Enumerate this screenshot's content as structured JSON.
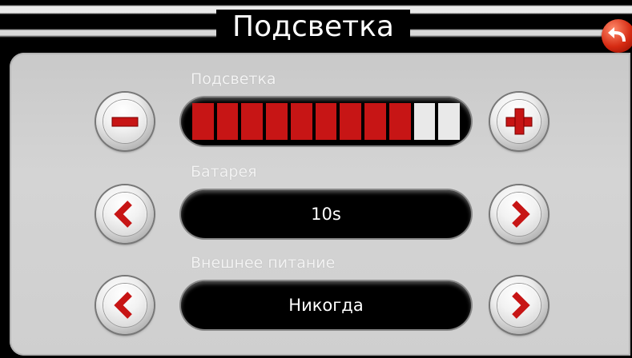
{
  "header": {
    "title": "Подсветка",
    "back_icon": "back-arrow-icon",
    "back_color": "#d52a12"
  },
  "backlight": {
    "label": "Подсветка",
    "level": 9,
    "max_level": 11,
    "minus_icon": "minus-icon",
    "plus_icon": "plus-icon",
    "active_color": "#c71515",
    "inactive_color": "#e9e9e9"
  },
  "battery": {
    "label": "Батарея",
    "value": "10s",
    "prev_icon": "chevron-left-icon",
    "next_icon": "chevron-right-icon"
  },
  "external_power": {
    "label": "Внешнее питание",
    "value": "Никогда",
    "prev_icon": "chevron-left-icon",
    "next_icon": "chevron-right-icon"
  }
}
